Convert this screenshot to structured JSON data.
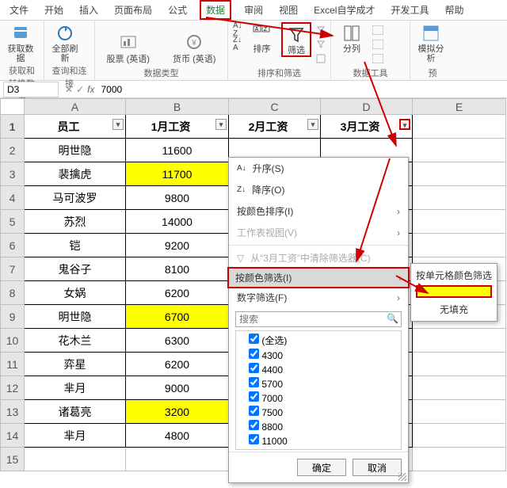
{
  "tabs": {
    "file": "文件",
    "home": "开始",
    "insert": "插入",
    "layout": "页面布局",
    "formula": "公式",
    "data": "数据",
    "review": "审阅",
    "view": "视图",
    "selfstudy": "Excel自学成才",
    "dev": "开发工具",
    "help": "帮助"
  },
  "ribbon": {
    "group1_label": "获取和转换数据",
    "get_data": "获取数\n据",
    "group2_label": "查询和连接",
    "refresh_all": "全部刷新",
    "group3_label": "数据类型",
    "stocks": "股票 (英语)",
    "currency": "货币 (英语)",
    "group4_label": "排序和筛选",
    "sort": "排序",
    "filter": "筛选",
    "group5_label": "数据工具",
    "text_to_col": "分列",
    "group6_label": "预",
    "whatif": "模拟分析"
  },
  "name_box": "D3",
  "formula_value": "7000",
  "cols": {
    "A": "A",
    "B": "B",
    "C": "C",
    "D": "D",
    "E": "E"
  },
  "header_row": {
    "A": "员工",
    "B": "1月工资",
    "C": "2月工资",
    "D": "3月工资"
  },
  "rows": [
    {
      "n": "2",
      "A": "明世隐",
      "B": "11600",
      "hy": false
    },
    {
      "n": "3",
      "A": "裴擒虎",
      "B": "11700",
      "hy": true
    },
    {
      "n": "4",
      "A": "马可波罗",
      "B": "9800",
      "hy": false
    },
    {
      "n": "5",
      "A": "苏烈",
      "B": "14000",
      "hy": false
    },
    {
      "n": "6",
      "A": "铠",
      "B": "9200",
      "hy": false
    },
    {
      "n": "7",
      "A": "鬼谷子",
      "B": "8100",
      "hy": false
    },
    {
      "n": "8",
      "A": "女娲",
      "B": "6200",
      "hy": false
    },
    {
      "n": "9",
      "A": "明世隐",
      "B": "6700",
      "hy": true
    },
    {
      "n": "10",
      "A": "花木兰",
      "B": "6300",
      "hy": false
    },
    {
      "n": "11",
      "A": "弈星",
      "B": "6200",
      "hy": false
    },
    {
      "n": "12",
      "A": "芈月",
      "B": "9000",
      "hy": false
    },
    {
      "n": "13",
      "A": "诸葛亮",
      "B": "3200",
      "hy": true
    },
    {
      "n": "14",
      "A": "芈月",
      "B": "4800",
      "hy": false
    }
  ],
  "filter": {
    "asc": "升序(S)",
    "desc": "降序(O)",
    "by_color_sort": "按颜色排序(I)",
    "sheet_view": "工作表视图(V)",
    "clear": "从“3月工资”中清除筛选器(C)",
    "by_color_filter": "按颜色筛选(I)",
    "num_filter": "数字筛选(F)",
    "search_placeholder": "搜索",
    "select_all": "(全选)",
    "values": [
      "4300",
      "4400",
      "5700",
      "7000",
      "7500",
      "8800",
      "11000"
    ],
    "ok": "确定",
    "cancel": "取消"
  },
  "submenu": {
    "title": "按单元格颜色筛选",
    "nofill": "无填充"
  },
  "chart_data": {
    "type": "table",
    "columns": [
      "员工",
      "1月工资"
    ],
    "highlight_column": "1月工资",
    "highlighted_rows": [
      "裴擒虎",
      "明世隐",
      "诸葛亮"
    ],
    "data": [
      [
        "明世隐",
        11600
      ],
      [
        "裴擒虎",
        11700
      ],
      [
        "马可波罗",
        9800
      ],
      [
        "苏烈",
        14000
      ],
      [
        "铠",
        9200
      ],
      [
        "鬼谷子",
        8100
      ],
      [
        "女娲",
        6200
      ],
      [
        "明世隐",
        6700
      ],
      [
        "花木兰",
        6300
      ],
      [
        "弈星",
        6200
      ],
      [
        "芈月",
        9000
      ],
      [
        "诸葛亮",
        3200
      ],
      [
        "芈月",
        4800
      ]
    ]
  }
}
